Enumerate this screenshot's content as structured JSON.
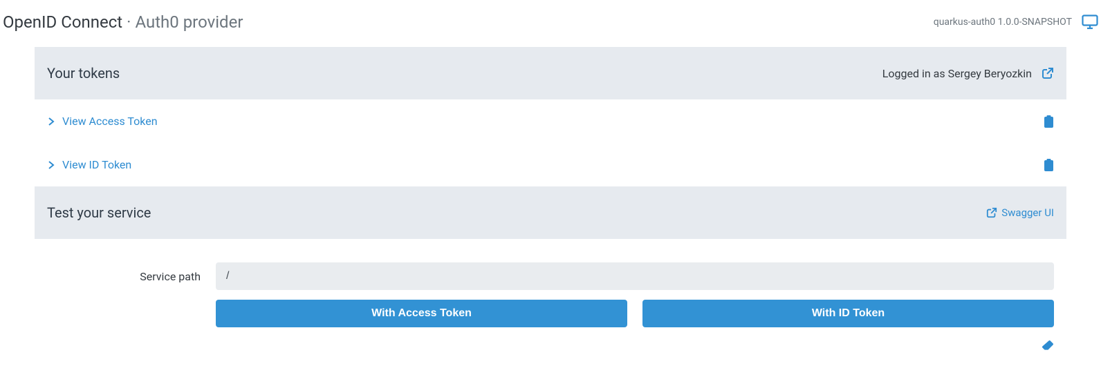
{
  "header": {
    "title": "OpenID Connect",
    "separator": " · ",
    "subtitle": "Auth0 provider",
    "app_info": "quarkus-auth0 1.0.0-SNAPSHOT"
  },
  "tokens_section": {
    "title": "Your tokens",
    "logged_in_text": "Logged in as Sergey Beryozkin",
    "view_access_token": "View Access Token",
    "view_id_token": "View ID Token"
  },
  "test_section": {
    "title": "Test your service",
    "swagger_label": "Swagger UI",
    "service_path_label": "Service path",
    "service_path_value": "/",
    "btn_with_access_token": "With Access Token",
    "btn_with_id_token": "With ID Token"
  }
}
